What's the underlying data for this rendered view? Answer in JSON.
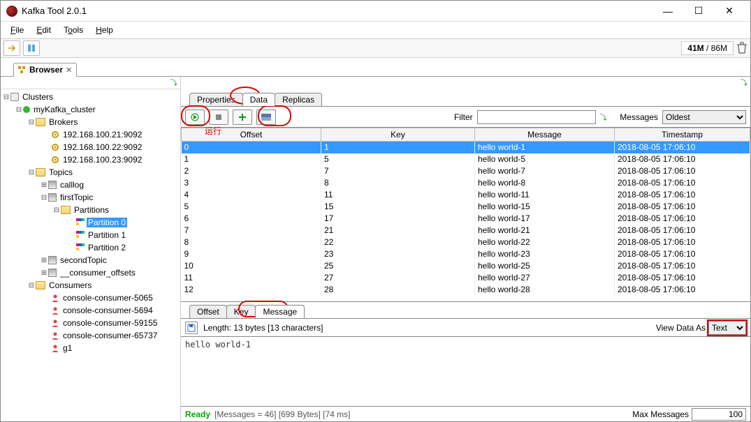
{
  "window": {
    "title": "Kafka Tool  2.0.1"
  },
  "menu": {
    "file": "File",
    "edit": "Edit",
    "tools": "Tools",
    "help": "Help"
  },
  "memory": {
    "used": "41M",
    "total": "86M"
  },
  "browser_tab": "Browser",
  "tree": {
    "root": "Clusters",
    "cluster": "myKafka_cluster",
    "brokers_label": "Brokers",
    "brokers": [
      "192.168.100.21:9092",
      "192.168.100.22:9092",
      "192.168.100.23:9092"
    ],
    "topics_label": "Topics",
    "topics": [
      {
        "name": "calllog",
        "expanded": false
      },
      {
        "name": "firstTopic",
        "expanded": true,
        "partitions_label": "Partitions",
        "partitions": [
          "Partition 0",
          "Partition 1",
          "Partition 2"
        ],
        "selected": 0
      },
      {
        "name": "secondTopic",
        "expanded": false
      },
      {
        "name": "__consumer_offsets",
        "expanded": false
      }
    ],
    "consumers_label": "Consumers",
    "consumers": [
      "console-consumer-5065",
      "console-consumer-5694",
      "console-consumer-59155",
      "console-consumer-65737",
      "g1"
    ]
  },
  "content_tabs": [
    "Properties",
    "Data",
    "Replicas"
  ],
  "active_tab": 1,
  "run_annotation": "运行",
  "filter_label": "Filter",
  "filter_value": "",
  "messages_label": "Messages",
  "messages_mode": "Oldest",
  "columns": [
    "Offset",
    "Key",
    "Message",
    "Timestamp"
  ],
  "rows": [
    {
      "offset": "0",
      "key": "1",
      "message": "hello world-1",
      "ts": "2018-08-05 17:06:10",
      "sel": true
    },
    {
      "offset": "1",
      "key": "5",
      "message": "hello world-5",
      "ts": "2018-08-05 17:06:10"
    },
    {
      "offset": "2",
      "key": "7",
      "message": "hello world-7",
      "ts": "2018-08-05 17:06:10"
    },
    {
      "offset": "3",
      "key": "8",
      "message": "hello world-8",
      "ts": "2018-08-05 17:06:10"
    },
    {
      "offset": "4",
      "key": "11",
      "message": "hello world-11",
      "ts": "2018-08-05 17:06:10"
    },
    {
      "offset": "5",
      "key": "15",
      "message": "hello world-15",
      "ts": "2018-08-05 17:06:10"
    },
    {
      "offset": "6",
      "key": "17",
      "message": "hello world-17",
      "ts": "2018-08-05 17:06:10"
    },
    {
      "offset": "7",
      "key": "21",
      "message": "hello world-21",
      "ts": "2018-08-05 17:06:10"
    },
    {
      "offset": "8",
      "key": "22",
      "message": "hello world-22",
      "ts": "2018-08-05 17:06:10"
    },
    {
      "offset": "9",
      "key": "23",
      "message": "hello world-23",
      "ts": "2018-08-05 17:06:10"
    },
    {
      "offset": "10",
      "key": "25",
      "message": "hello world-25",
      "ts": "2018-08-05 17:06:10"
    },
    {
      "offset": "11",
      "key": "27",
      "message": "hello world-27",
      "ts": "2018-08-05 17:06:10"
    },
    {
      "offset": "12",
      "key": "28",
      "message": "hello world-28",
      "ts": "2018-08-05 17:06:10"
    }
  ],
  "detail_tabs": [
    "Offset",
    "Key",
    "Message"
  ],
  "detail_active": 2,
  "length_text": "Length: 13 bytes [13 characters]",
  "view_as_label": "View Data As",
  "view_as_value": "Text",
  "message_body": "hello world-1",
  "status": {
    "ready": "Ready",
    "info": "[Messages = 46]  [699 Bytes]  [74 ms]",
    "max_label": "Max Messages",
    "max_value": "100"
  }
}
